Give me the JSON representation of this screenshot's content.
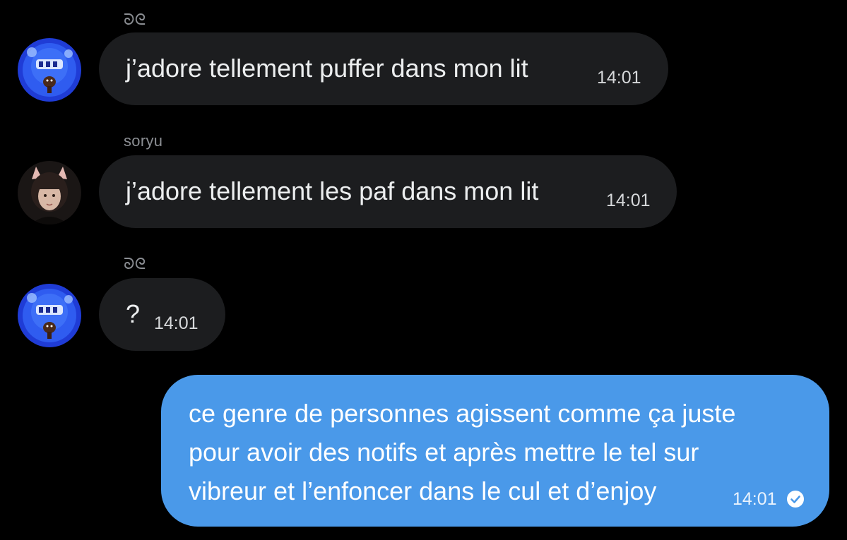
{
  "messages": [
    {
      "sender": "ᘐᘓ",
      "avatar": "blue-cartoon-face-avatar",
      "text": "j’adore tellement puffer dans mon lit",
      "time": "14:01"
    },
    {
      "sender": "soryu",
      "avatar": "girl-with-cat-ears-avatar",
      "text": "j’adore tellement les paf dans mon lit",
      "time": "14:01"
    },
    {
      "sender": "ᘐᘓ",
      "avatar": "blue-cartoon-face-avatar",
      "text": "?",
      "time": "14:01"
    }
  ],
  "outgoing": {
    "lines": [
      "ce genre de personnes agissent comme ça juste",
      "pour avoir des notifs et après mettre le tel sur",
      "vibreur et l’enfoncer dans le cul et d’enjoy"
    ],
    "time": "14:01",
    "status_icon": "read-check-icon"
  },
  "colors": {
    "background": "#000000",
    "incoming_bubble": "#1c1d1f",
    "outgoing_bubble": "#4a99e9",
    "sender_name": "#8b8e93"
  }
}
